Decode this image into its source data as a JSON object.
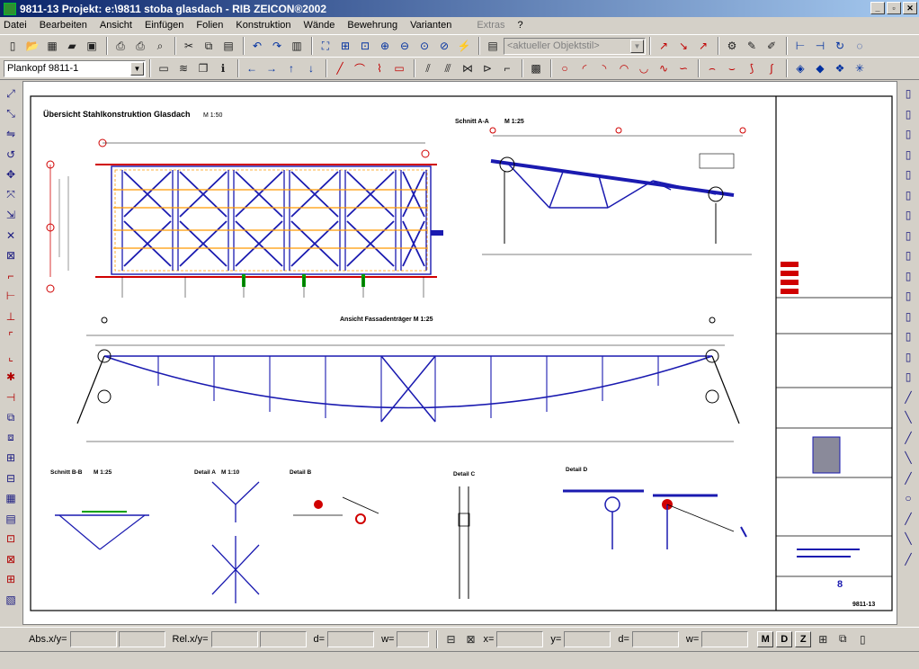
{
  "window": {
    "title": "9811-13  Projekt: e:\\9811 stoba glasdach  -  RIB ZEICON®2002"
  },
  "menu": [
    "Datei",
    "Bearbeiten",
    "Ansicht",
    "Einfügen",
    "Folien",
    "Konstruktion",
    "Wände",
    "Bewehrung",
    "Varianten",
    "Extras",
    "?"
  ],
  "toolbar": {
    "objektstil_placeholder": "<aktueller Objektstil>",
    "plankopf_value": "Plankopf 9811-1"
  },
  "drawing": {
    "title_main": "Übersicht Stahlkonstruktion Glasdach",
    "title_scale": "M 1:50",
    "label_schnitt_a": "Schnitt A-A",
    "label_schnitt_a_scale": "M 1:25",
    "label_ansicht": "Ansicht Fassadenträger M 1:25",
    "label_schnitt_bb": "Schnitt B-B",
    "label_schnitt_bb_scale": "M 1:25",
    "label_detail_a": "Detail A",
    "label_detail_a_scale": "M 1:10",
    "label_detail_b": "Detail B",
    "label_detail_c": "Detail C",
    "label_detail_d": "Detail D",
    "plan_number": "9811-13"
  },
  "status": {
    "abs_label": "Abs.x/y=",
    "rel_label": "Rel.x/y=",
    "d_label": "d=",
    "w_label": "w=",
    "x_label": "x=",
    "y_label": "y=",
    "d2_label": "d=",
    "w2_label": "w=",
    "btn_m": "M",
    "btn_d": "D",
    "btn_z": "Z"
  },
  "colors": {
    "titlebar_start": "#0a246a",
    "drawing_blue": "#1a1ab0",
    "drawing_red": "#d00000",
    "drawing_orange": "#ff9900",
    "drawing_green": "#00a000"
  }
}
